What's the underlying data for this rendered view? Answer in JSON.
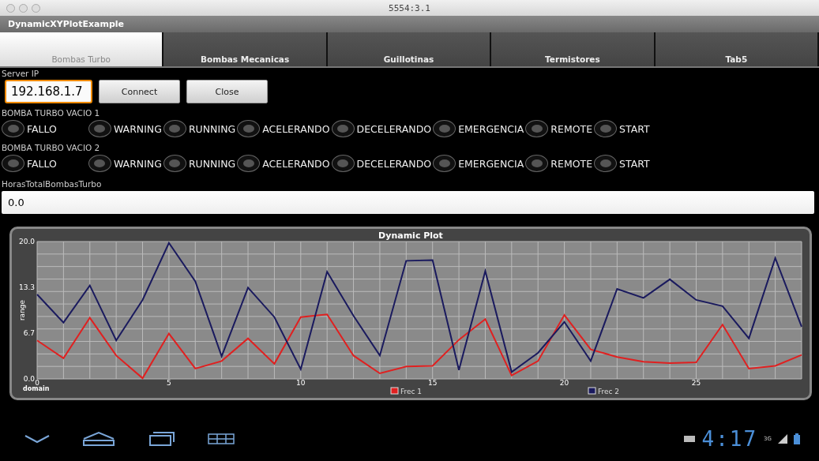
{
  "window": {
    "title": "5554:3.1"
  },
  "app": {
    "title": "DynamicXYPlotExample"
  },
  "tabs": [
    {
      "label": "Bombas Turbo",
      "selected": true
    },
    {
      "label": "Bombas Mecanicas",
      "selected": false
    },
    {
      "label": "Guillotinas",
      "selected": false
    },
    {
      "label": "Termistores",
      "selected": false
    },
    {
      "label": "Tab5",
      "selected": false
    }
  ],
  "server": {
    "label": "Server IP",
    "value": "192.168.1.7",
    "buttons": [
      "Connect",
      "Close"
    ]
  },
  "pumps": [
    {
      "title": "BOMBA TURBO VACIO 1",
      "states": [
        {
          "label": "FALLO",
          "checked": false
        },
        {
          "label": "WARNING",
          "checked": false
        },
        {
          "label": "RUNNING",
          "checked": false
        },
        {
          "label": "ACELERANDO",
          "checked": false
        },
        {
          "label": "DECELERANDO",
          "checked": false
        },
        {
          "label": "EMERGENCIA",
          "checked": false
        },
        {
          "label": "REMOTE",
          "checked": false
        },
        {
          "label": "START",
          "checked": false
        }
      ]
    },
    {
      "title": "BOMBA TURBO VACIO 2",
      "states": [
        {
          "label": "FALLO",
          "checked": false
        },
        {
          "label": "WARNING",
          "checked": false
        },
        {
          "label": "RUNNING",
          "checked": false
        },
        {
          "label": "ACELERANDO",
          "checked": false
        },
        {
          "label": "DECELERANDO",
          "checked": false
        },
        {
          "label": "EMERGENCIA",
          "checked": false
        },
        {
          "label": "REMOTE",
          "checked": false
        },
        {
          "label": "START",
          "checked": false
        }
      ]
    }
  ],
  "hours": {
    "label": "HorasTotalBombasTurbo",
    "value": "0.0"
  },
  "plot": {
    "chart_data": {
      "type": "line",
      "title": "Dynamic Plot",
      "grid": true,
      "legend": true,
      "xlabel": "domain",
      "ylabel": "range",
      "x": [
        0,
        1,
        2,
        3,
        4,
        5,
        6,
        7,
        8,
        9,
        10,
        11,
        12,
        13,
        14,
        15,
        16,
        17,
        18,
        19,
        20,
        21,
        22,
        23,
        24,
        25,
        26,
        27,
        28,
        29
      ],
      "xlim": [
        0,
        29
      ],
      "ylim": [
        0,
        20
      ],
      "xticks": [
        0,
        5,
        10,
        15,
        20,
        25
      ],
      "yticks": [
        {
          "value": 0,
          "label": "0.0"
        },
        {
          "value": 6.7,
          "label": "6.7"
        },
        {
          "value": 13.3,
          "label": "13.3"
        },
        {
          "value": 20,
          "label": "20.0"
        }
      ],
      "series": [
        {
          "name": "Frec 1",
          "color": "#e02020",
          "values": [
            5.6,
            3.0,
            8.9,
            3.4,
            0.1,
            6.6,
            1.5,
            2.6,
            5.9,
            2.2,
            9.0,
            9.4,
            3.4,
            0.8,
            1.8,
            1.9,
            5.7,
            8.7,
            0.5,
            2.6,
            9.3,
            4.3,
            3.2,
            2.5,
            2.3,
            2.4,
            7.9,
            1.5,
            1.9,
            3.5
          ]
        },
        {
          "name": "Frec 2",
          "color": "#1a1a5e",
          "values": [
            12.3,
            8.2,
            13.6,
            5.6,
            11.5,
            19.8,
            14.2,
            3.3,
            13.3,
            9.0,
            1.4,
            15.6,
            9.2,
            3.4,
            17.2,
            17.3,
            1.3,
            15.7,
            1.0,
            3.8,
            8.3,
            2.6,
            13.1,
            11.8,
            14.5,
            11.5,
            10.6,
            5.9,
            17.6,
            7.6
          ]
        }
      ]
    }
  },
  "status": {
    "time": "4:17",
    "network": "3G"
  }
}
